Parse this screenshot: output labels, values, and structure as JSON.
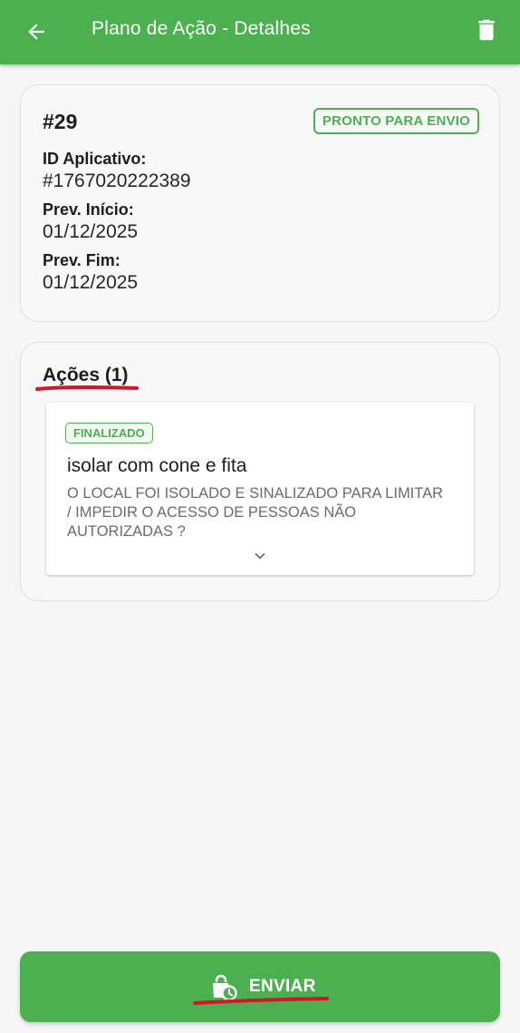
{
  "appbar": {
    "title": "Plano de Ação - Detalhes",
    "back_icon": "arrow-left-icon",
    "delete_icon": "trash-icon",
    "color": "#4caf50"
  },
  "plan": {
    "number": "#29",
    "status": "PRONTO PARA ENVIO",
    "fields": [
      {
        "label": "ID Aplicativo:",
        "value": "#1767020222389"
      },
      {
        "label": "Prev. Início:",
        "value": "01/12/2025"
      },
      {
        "label": "Prev. Fim:",
        "value": "01/12/2025"
      }
    ]
  },
  "acoes": {
    "title": "Ações (1)",
    "items": [
      {
        "status": "FINALIZADO",
        "name": "isolar com cone e fita",
        "description": "O LOCAL FOI ISOLADO E SINALIZADO PARA LIMITAR / IMPEDIR O ACESSO DE PESSOAS NÃO AUTORIZADAS ?",
        "expand_icon": "chevron-down-icon"
      }
    ]
  },
  "footer": {
    "send_label": "ENVIAR",
    "send_icon": "bag-clock-icon"
  },
  "colors": {
    "accent": "#4caf50",
    "annotation": "#d0182a"
  }
}
